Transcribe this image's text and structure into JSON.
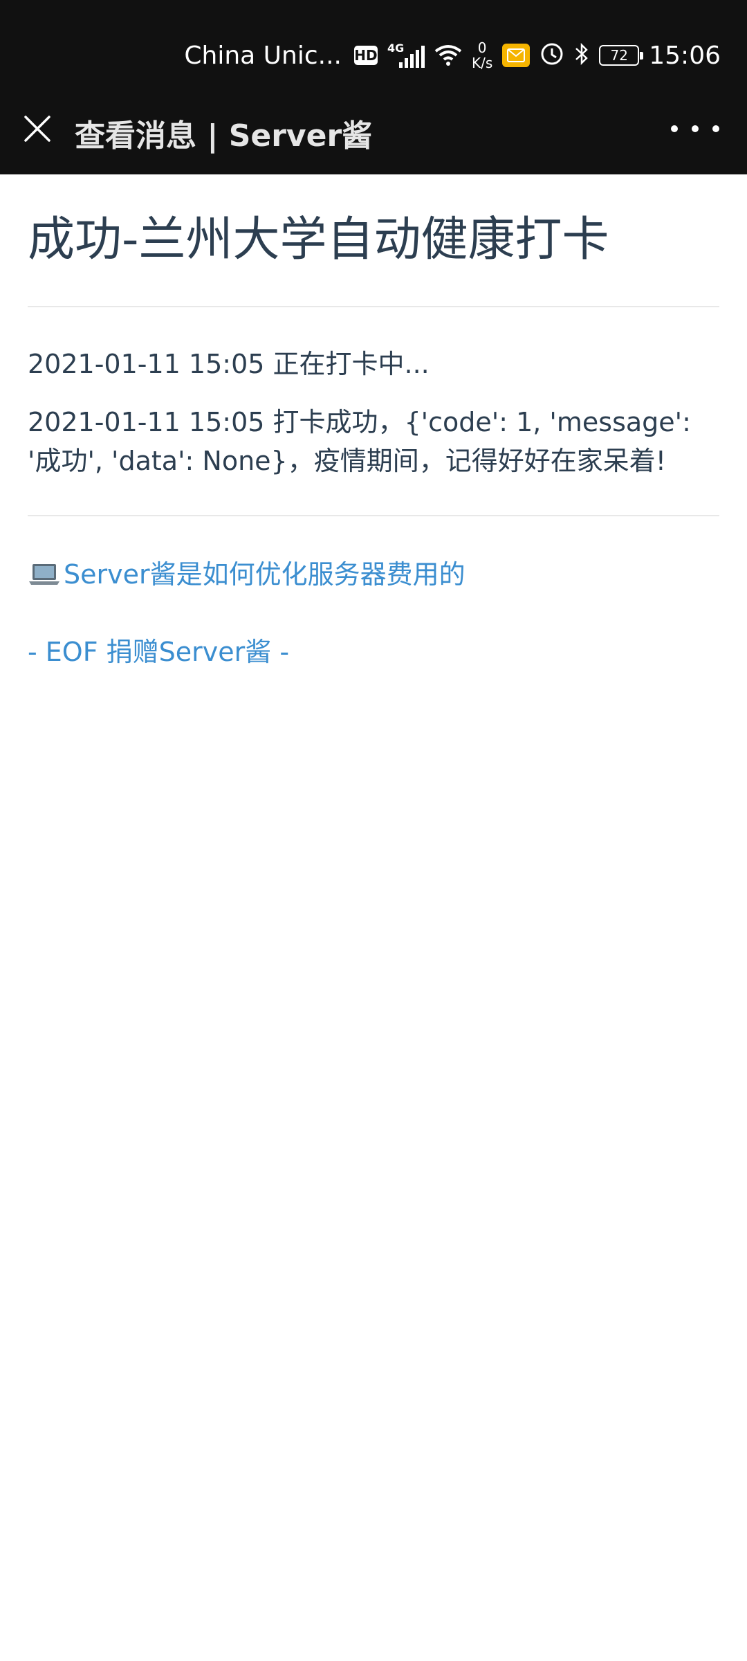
{
  "status_bar": {
    "carrier": "China Unic...",
    "hd": "HD",
    "network": "4G",
    "speed_value": "0",
    "speed_unit": "K/s",
    "battery": "72",
    "time": "15:06"
  },
  "nav": {
    "title": "查看消息 | Server酱"
  },
  "message": {
    "title": "成功-兰州大学自动健康打卡",
    "lines": [
      "2021-01-11 15:05 正在打卡中...",
      "2021-01-11 15:05 打卡成功，{'code': 1, 'message': '成功', 'data': None}，疫情期间，记得好好在家呆着!"
    ]
  },
  "footer": {
    "article_link": "Server酱是如何优化服务器费用的",
    "eof": "- EOF 捐赠Server酱 -"
  },
  "colors": {
    "bar_bg": "#111111",
    "text": "#2c3e50",
    "link": "#3b8ed0",
    "mail_icon": "#f5b400"
  },
  "icons": {
    "close": "close-icon",
    "more": "more-icon",
    "laptop": "laptop-icon"
  }
}
